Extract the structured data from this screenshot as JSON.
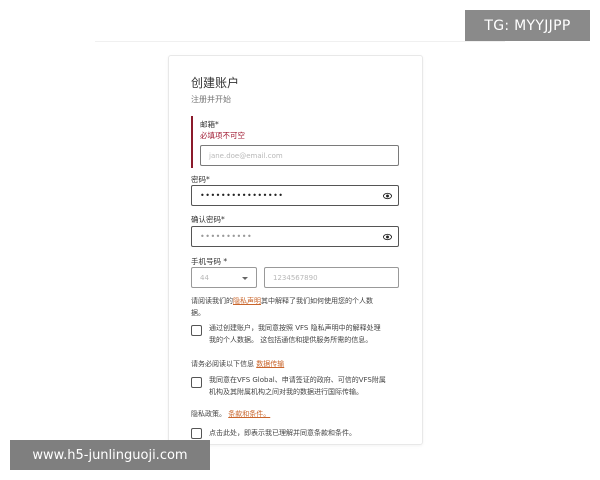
{
  "watermarks": {
    "top": "TG: MYYJJPP",
    "bottom": "www.h5-junlinguoji.com"
  },
  "form": {
    "title": "创建账户",
    "subtitle": "注册并开始",
    "email": {
      "label": "邮箱*",
      "error": "必填项不可空",
      "placeholder": "jane.doe@email.com"
    },
    "password": {
      "label": "密码*",
      "value": "••••••••••••••••"
    },
    "confirm_password": {
      "label": "确认密码*",
      "value": "••••••••••"
    },
    "phone": {
      "label": "手机号码 *",
      "country_code": "44",
      "placeholder": "1234567890"
    },
    "privacy_notice": {
      "pre": "请阅读我们的",
      "link": "隐私声明",
      "post": "其中解释了我们如何使用您的个人数",
      "line2": "据。"
    },
    "consent_1": {
      "line1": "通过创建账户，我同意按照 VFS 隐私声明中的解释处理",
      "line2": "我的个人数据。 这包括通信和提供服务所需的信息。"
    },
    "data_transfer_notice": {
      "pre": "请务必阅读以下信息",
      "link": "数据传输"
    },
    "consent_2": {
      "line1": "我同意在VFS Global、申请签证的政府、可信的VFS附属",
      "line2": "机构及其附属机构之间对我的数据进行国际传输。"
    },
    "privacy_policy": {
      "pre": "隐私政策。",
      "link": "条款和条件。"
    },
    "consent_3": {
      "line1": "点击此处，即表示我已理解并同意条款和条件。"
    }
  }
}
